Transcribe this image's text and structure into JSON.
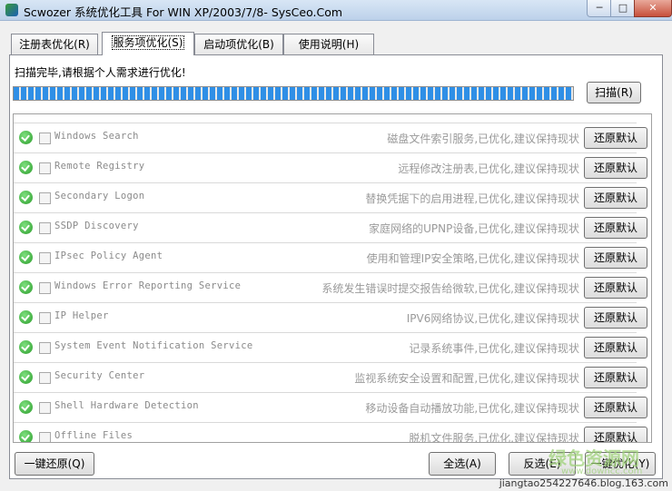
{
  "window": {
    "title": "Scwozer 系统优化工具 For WIN XP/2003/7/8- SysCeo.Com",
    "min_glyph": "─",
    "max_glyph": "□",
    "close_glyph": "✕"
  },
  "tabs": [
    {
      "label": "注册表优化(R)",
      "active": false
    },
    {
      "label": "服务项优化(S)",
      "active": true
    },
    {
      "label": "启动项优化(B)",
      "active": false
    },
    {
      "label": "使用说明(H)",
      "active": false
    }
  ],
  "status_text": "扫描完毕,请根据个人需求进行优化!",
  "progress": 1.0,
  "scan_button": "扫描(R)",
  "restore_label": "还原默认",
  "services": [
    {
      "name": "Windows Search",
      "desc": "磁盘文件索引服务,已优化,建议保持现状"
    },
    {
      "name": "Remote Registry",
      "desc": "远程修改注册表,已优化,建议保持现状"
    },
    {
      "name": "Secondary Logon",
      "desc": "替换凭据下的启用进程,已优化,建议保持现状"
    },
    {
      "name": "SSDP Discovery",
      "desc": "家庭网络的UPNP设备,已优化,建议保持现状"
    },
    {
      "name": "IPsec Policy Agent",
      "desc": "使用和管理IP安全策略,已优化,建议保持现状"
    },
    {
      "name": "Windows Error Reporting Service",
      "desc": "系统发生错误时提交报告给微软,已优化,建议保持现状"
    },
    {
      "name": "IP Helper",
      "desc": "IPV6网络协议,已优化,建议保持现状"
    },
    {
      "name": "System Event Notification Service",
      "desc": "记录系统事件,已优化,建议保持现状"
    },
    {
      "name": "Security Center",
      "desc": "监视系统安全设置和配置,已优化,建议保持现状"
    },
    {
      "name": "Shell Hardware Detection",
      "desc": "移动设备自动播放功能,已优化,建议保持现状"
    },
    {
      "name": "Offline Files",
      "desc": "脱机文件服务,已优化,建议保持现状"
    }
  ],
  "bottom": {
    "restore_all": "一键还原(Q)",
    "select_all": "全选(A)",
    "invert": "反选(E)",
    "optimize": "一键优化(Y)"
  },
  "watermark": {
    "logo": "绿色资源网",
    "url": "www.downcc.com",
    "credit": "jiangtao254227646.blog.163.com"
  },
  "colors": {
    "progress": "#2f8fe6",
    "ok_icon": "#2c9d2c"
  }
}
